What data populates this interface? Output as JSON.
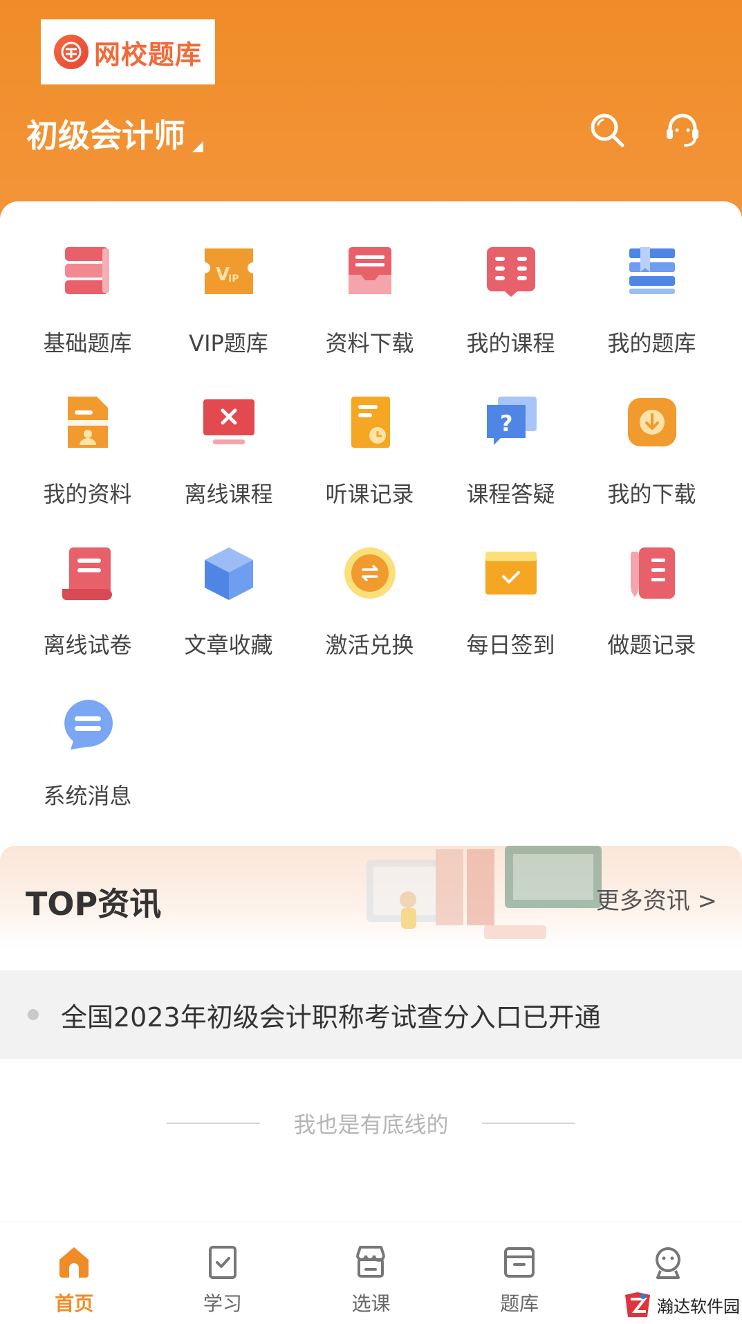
{
  "header": {
    "logo_text": "网校题库",
    "exam_name": "初级会计师"
  },
  "colors": {
    "brand_orange": "#f08c28",
    "tab_active": "#f08c28"
  },
  "menu": {
    "items": [
      {
        "label": "基础题库",
        "icon": "books-icon"
      },
      {
        "label": "VIP题库",
        "icon": "vip-ticket-icon"
      },
      {
        "label": "资料下载",
        "icon": "tray-download-icon"
      },
      {
        "label": "我的课程",
        "icon": "open-book-icon"
      },
      {
        "label": "我的题库",
        "icon": "bookmark-list-icon"
      },
      {
        "label": "我的资料",
        "icon": "user-document-icon"
      },
      {
        "label": "离线课程",
        "icon": "offline-screen-icon"
      },
      {
        "label": "听课记录",
        "icon": "clock-document-icon"
      },
      {
        "label": "课程答疑",
        "icon": "question-chat-icon"
      },
      {
        "label": "我的下载",
        "icon": "download-icon"
      },
      {
        "label": "离线试卷",
        "icon": "scroll-paper-icon"
      },
      {
        "label": "文章收藏",
        "icon": "cube-icon"
      },
      {
        "label": "激活兑换",
        "icon": "exchange-coin-icon"
      },
      {
        "label": "每日签到",
        "icon": "check-card-icon"
      },
      {
        "label": "做题记录",
        "icon": "notebook-pencil-icon"
      },
      {
        "label": "系统消息",
        "icon": "message-bubble-icon"
      }
    ]
  },
  "news": {
    "title": "TOP资讯",
    "more_label": "更多资讯 >",
    "items": [
      {
        "text": "全国2023年初级会计职称考试查分入口已开通"
      }
    ]
  },
  "footer_note": "我也是有底线的",
  "tabs": [
    {
      "label": "首页",
      "icon": "home-icon",
      "active": true
    },
    {
      "label": "学习",
      "icon": "clipboard-check-icon",
      "active": false
    },
    {
      "label": "选课",
      "icon": "store-icon",
      "active": false
    },
    {
      "label": "题库",
      "icon": "archive-box-icon",
      "active": false
    },
    {
      "label": "",
      "icon": "robot-icon",
      "active": false
    }
  ],
  "watermark": {
    "text": "瀚达软件园"
  }
}
